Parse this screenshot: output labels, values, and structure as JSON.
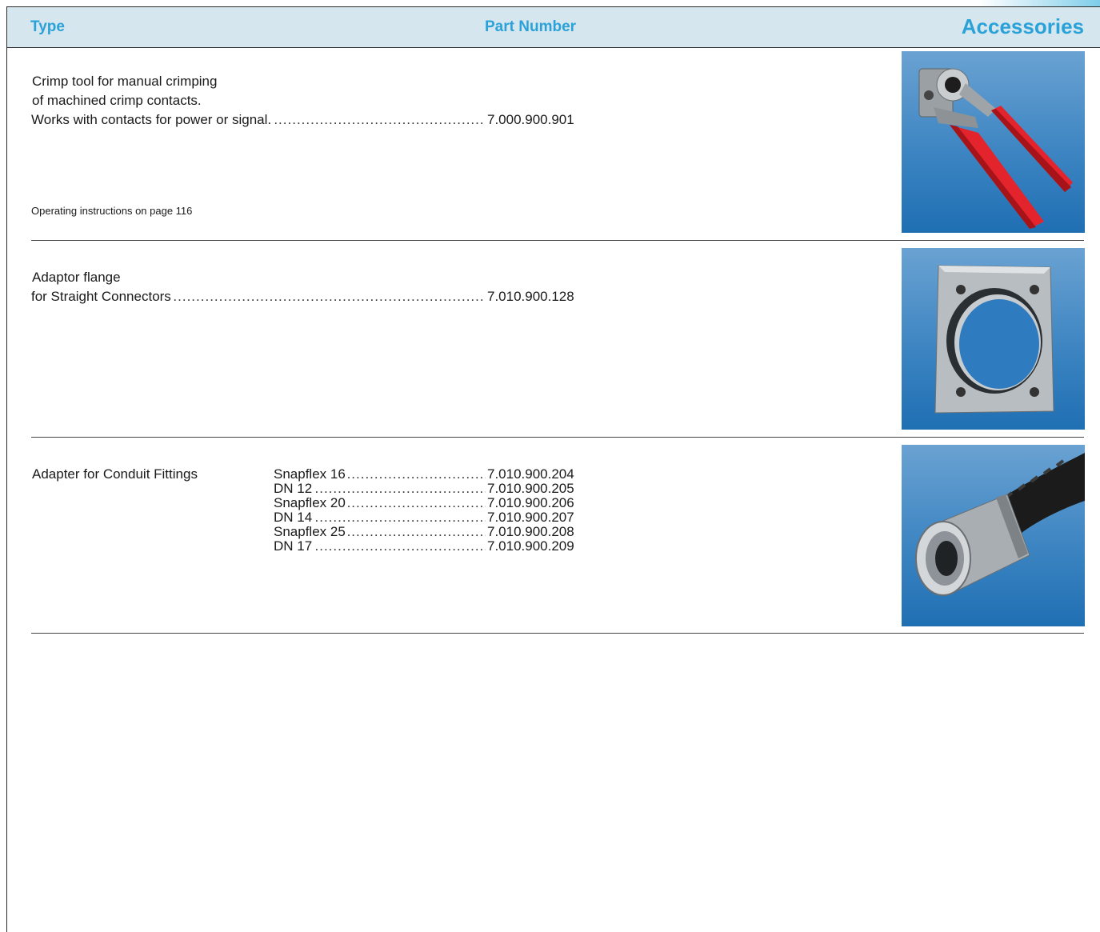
{
  "header": {
    "type_label": "Type",
    "part_number_label": "Part Number",
    "section_title": "Accessories"
  },
  "items": [
    {
      "lines": [
        "Crimp tool for manual crimping",
        "of machined crimp contacts."
      ],
      "leader_label": "Works with contacts for power or signal.",
      "part_number": "7.000.900.901",
      "note": "Operating instructions on page 116",
      "image": "crimp-tool-photo"
    },
    {
      "lines": [
        "Adaptor flange"
      ],
      "leader_label": "for Straight Connectors",
      "part_number": "7.010.900.128",
      "image": "adaptor-flange-photo"
    },
    {
      "title": "Adapter for Conduit Fittings",
      "variants": [
        {
          "label": "Snapflex 16",
          "part_number": "7.010.900.204"
        },
        {
          "label": "DN 12",
          "part_number": "7.010.900.205"
        },
        {
          "label": "Snapflex 20",
          "part_number": "7.010.900.206"
        },
        {
          "label": "DN 14",
          "part_number": "7.010.900.207"
        },
        {
          "label": "Snapflex 25",
          "part_number": "7.010.900.208"
        },
        {
          "label": "DN 17",
          "part_number": "7.010.900.209"
        }
      ],
      "image": "conduit-adapter-photo"
    }
  ],
  "colors": {
    "heading": "#2aa2d8",
    "header_bg": "#d6e6ef",
    "photo_bg": "#2f7bbf"
  }
}
